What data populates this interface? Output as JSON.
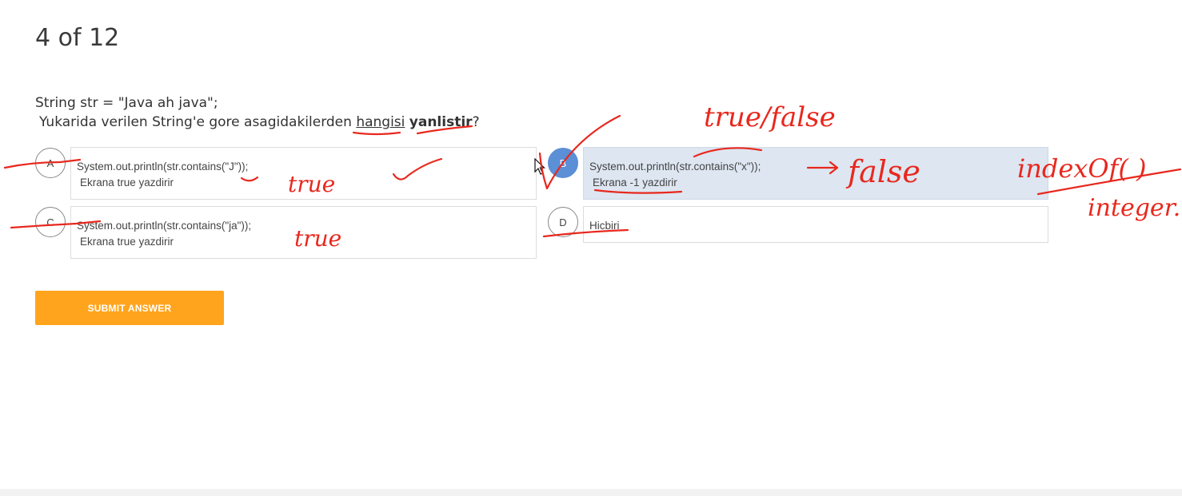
{
  "progress": "4 of 12",
  "question": {
    "line1": "String str = \"Java ah java\";",
    "line2_prefix": "Yukarida verilen String'e gore asagidakilerden ",
    "line2_word1": "hangisi",
    "line2_word2": "yanlistir",
    "line2_suffix": "?"
  },
  "options": [
    {
      "letter": "A",
      "line1": "System.out.println(str.contains(\"J\"));",
      "line2": "Ekrana true yazdirir"
    },
    {
      "letter": "B",
      "line1": "System.out.println(str.contains(\"x\"));",
      "line2": "Ekrana -1 yazdirir",
      "selected": true
    },
    {
      "letter": "C",
      "line1": "System.out.println(str.contains(\"ja\"));",
      "line2": "Ekrana true yazdirir"
    },
    {
      "letter": "D",
      "line1": "Hicbiri",
      "line2": ""
    }
  ],
  "submit_label": "SUBMIT ANSWER",
  "annotations": {
    "true_false": "true/false",
    "true_a": "true",
    "false_b": "false",
    "index_of": "indexOf( )",
    "integer": "integer.",
    "true_c": "true"
  },
  "colors": {
    "accent": "#ffa41c",
    "selected_marker": "#5b8fd6",
    "selected_box": "#dde6f1",
    "ink": "#e8281e"
  }
}
